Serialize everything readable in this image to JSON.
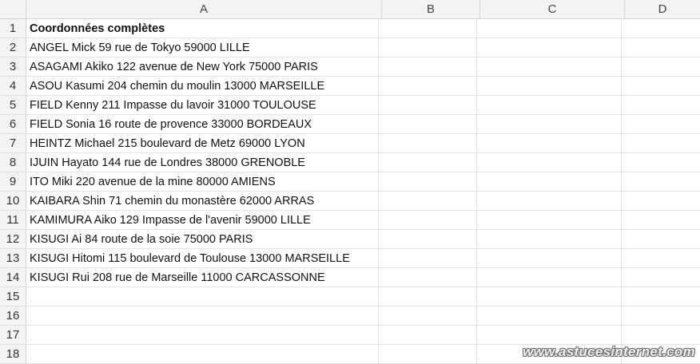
{
  "columns": [
    "A",
    "B",
    "C",
    "D"
  ],
  "rows": [
    {
      "num": "1",
      "a": "Coordonnées complètes"
    },
    {
      "num": "2",
      "a": "ANGEL Mick 59 rue de Tokyo 59000 LILLE"
    },
    {
      "num": "3",
      "a": "ASAGAMI Akiko 122 avenue de New York 75000 PARIS"
    },
    {
      "num": "4",
      "a": "ASOU Kasumi 204 chemin du moulin 13000 MARSEILLE"
    },
    {
      "num": "5",
      "a": "FIELD Kenny 211 Impasse du lavoir 31000 TOULOUSE"
    },
    {
      "num": "6",
      "a": "FIELD Sonia 16 route de provence 33000 BORDEAUX"
    },
    {
      "num": "7",
      "a": "HEINTZ Michael 215 boulevard de Metz 69000 LYON"
    },
    {
      "num": "8",
      "a": "IJUIN Hayato  144 rue de Londres 38000 GRENOBLE"
    },
    {
      "num": "9",
      "a": "ITO Miki 220 avenue de la mine 80000 AMIENS"
    },
    {
      "num": "10",
      "a": "KAIBARA Shin 71 chemin du monastère 62000 ARRAS"
    },
    {
      "num": "11",
      "a": "KAMIMURA Aiko 129 Impasse de l'avenir 59000 LILLE"
    },
    {
      "num": "12",
      "a": "KISUGI Ai 84 route de la soie 75000 PARIS"
    },
    {
      "num": "13",
      "a": "KISUGI Hitomi 115 boulevard de Toulouse 13000 MARSEILLE"
    },
    {
      "num": "14",
      "a": "KISUGI Rui 208 rue de Marseille 11000 CARCASSONNE"
    },
    {
      "num": "15",
      "a": ""
    },
    {
      "num": "16",
      "a": ""
    },
    {
      "num": "17",
      "a": ""
    },
    {
      "num": "18",
      "a": ""
    }
  ],
  "watermark": "www.astucesinternet.com"
}
